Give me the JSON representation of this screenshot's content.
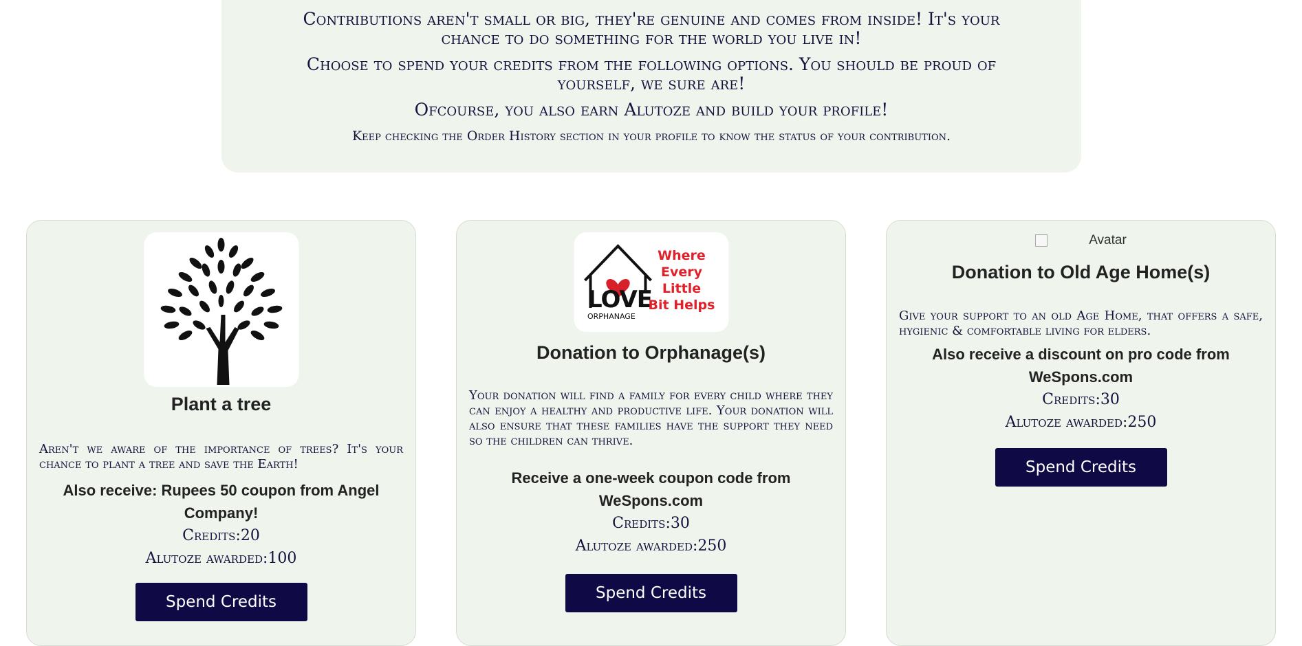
{
  "intro": {
    "line1": "Contributions aren't small or big, they're genuine and comes from inside! It's your chance to do something for the world you live in!",
    "line2": "Choose to spend your credits from the following options. You should be proud of yourself, we sure are!",
    "line3": "Ofcourse, you also earn Alutoze and build your profile!",
    "line4": "Keep checking the Order History section in your profile to know the status of your contribution."
  },
  "cards": [
    {
      "title": "Plant a tree",
      "description": "Aren't we aware of the importance of trees? It's your chance to plant a tree and save the Earth!",
      "offer": "Also receive: Rupees 50 coupon from Angel Company!",
      "credits": "Credits:20",
      "alutoze": "Alutoze awarded:100",
      "button": "Spend Credits",
      "icon": "tree-icon"
    },
    {
      "title": "Donation to Orphanage(s)",
      "description": "Your donation will find a family for every child where they can enjoy a healthy and productive life. Your donation will also ensure that these families have the support they need so the children can thrive.",
      "offer": "Receive a one-week coupon code from WeSpons.com",
      "credits": "Credits:30",
      "alutoze": "Alutoze awarded:250",
      "button": "Spend Credits",
      "logo_main": "LOVE",
      "logo_sub": "ORPHANAGE",
      "logo_lines": [
        "Where",
        "Every",
        "Little",
        "Bit Helps"
      ]
    },
    {
      "image_alt": "Avatar",
      "title": "Donation to Old Age Home(s)",
      "description": "Give your support to an old Age Home, that offers a safe, hygienic & comfortable living for elders.",
      "offer": "Also receive a discount on pro code from WeSpons.com",
      "credits": "Credits:30",
      "alutoze": "Alutoze awarded:250",
      "button": "Spend Credits"
    }
  ],
  "colors": {
    "panel_bg": "#eff5ec",
    "button_bg": "#0f0a45",
    "text_dark": "#14123e",
    "logo_red": "#e0202a"
  }
}
